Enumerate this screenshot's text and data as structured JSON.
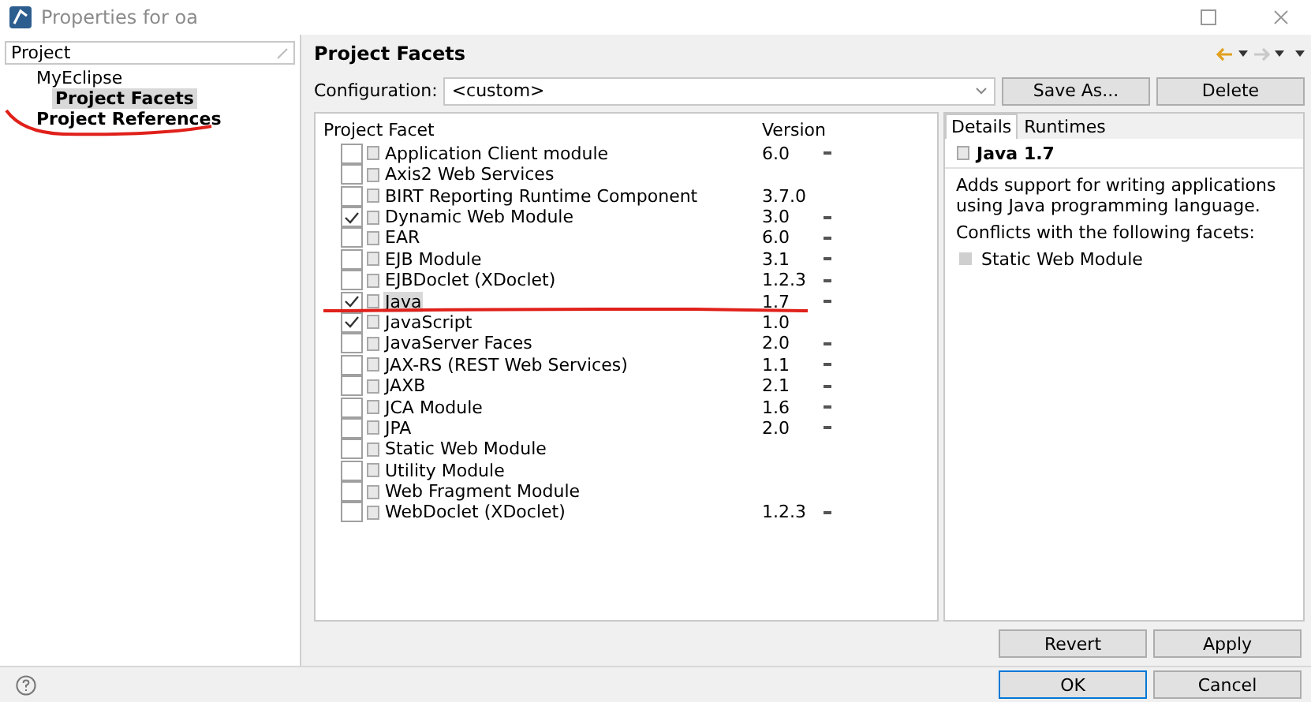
{
  "window": {
    "title": "Properties for oa"
  },
  "sidebar": {
    "filter": "Project",
    "items": [
      {
        "label": "MyEclipse",
        "selected": false,
        "children": [
          {
            "label": "Project Facets",
            "selected": true
          }
        ]
      },
      {
        "label": "Project References",
        "selected": false
      }
    ]
  },
  "page": {
    "title": "Project Facets",
    "configuration_label": "Configuration:",
    "configuration_value": "<custom>",
    "buttons": [
      "Save As...",
      "Delete"
    ]
  },
  "table": {
    "columns": [
      "Project Facet",
      "Version"
    ],
    "rows": [
      {
        "name": "Application Client module",
        "version": "6.0",
        "version_menu": true,
        "checked": false
      },
      {
        "name": "Axis2 Web Services",
        "version_menu": false,
        "checked": false
      },
      {
        "name": "BIRT Reporting Runtime Component",
        "version": "3.7.0",
        "version_menu": false,
        "checked": false
      },
      {
        "name": "Dynamic Web Module",
        "version": "3.0",
        "version_menu": true,
        "checked": true
      },
      {
        "name": "EAR",
        "version": "6.0",
        "version_menu": true,
        "checked": false
      },
      {
        "name": "EJB Module",
        "version": "3.1",
        "version_menu": true,
        "checked": false
      },
      {
        "name": "EJBDoclet (XDoclet)",
        "version": "1.2.3",
        "version_menu": true,
        "checked": false
      },
      {
        "name": "Java",
        "version": "1.7",
        "version_menu": true,
        "checked": true,
        "selected": true
      },
      {
        "name": "JavaScript",
        "version": "1.0",
        "version_menu": false,
        "checked": true
      },
      {
        "name": "JavaServer Faces",
        "version": "2.0",
        "version_menu": true,
        "checked": false
      },
      {
        "name": "JAX-RS (REST Web Services)",
        "version": "1.1",
        "version_menu": true,
        "checked": false
      },
      {
        "name": "JAXB",
        "version": "2.1",
        "version_menu": true,
        "checked": false
      },
      {
        "name": "JCA Module",
        "version": "1.6",
        "version_menu": true,
        "checked": false
      },
      {
        "name": "JPA",
        "version": "2.0",
        "version_menu": true,
        "checked": false
      },
      {
        "name": "Static Web Module",
        "version_menu": false,
        "checked": false
      },
      {
        "name": "Utility Module",
        "version_menu": false,
        "checked": false
      },
      {
        "name": "Web Fragment Module",
        "version_menu": false,
        "checked": false
      },
      {
        "name": "WebDoclet (XDoclet)",
        "version": "1.2.3",
        "version_menu": true,
        "checked": false
      }
    ]
  },
  "details": {
    "tabs": [
      {
        "label": "Details",
        "selected": true
      },
      {
        "label": "Runtimes",
        "selected": false
      }
    ],
    "heading": "Java 1.7",
    "description": "Adds support for writing applications using Java programming language.",
    "conflicts_label": "Conflicts with the following facets:",
    "conflicts": [
      "Static Web Module"
    ]
  },
  "page_buttons": [
    "Revert",
    "Apply"
  ],
  "dialog_buttons": [
    "OK",
    "Cancel"
  ]
}
